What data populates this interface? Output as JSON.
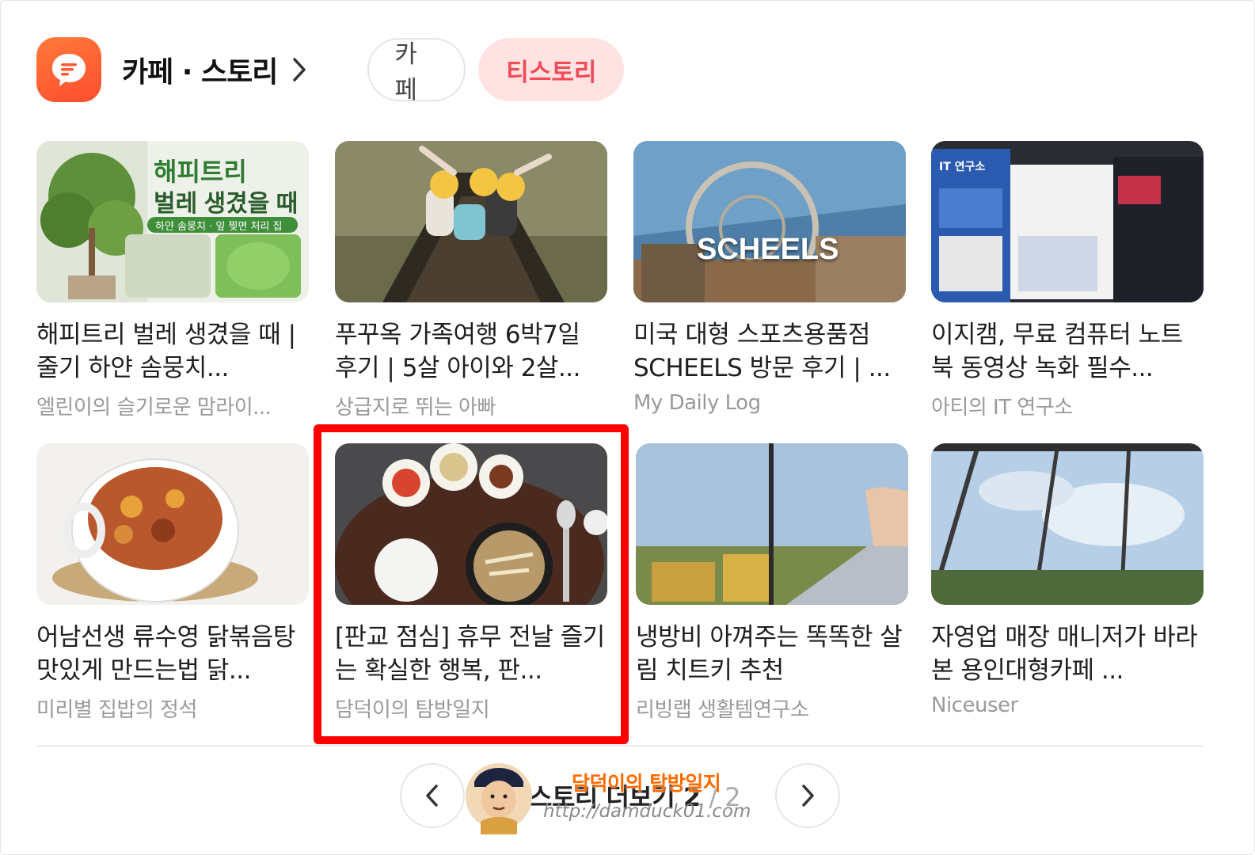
{
  "header": {
    "title": "카페 · 스토리",
    "tabs": [
      "카페",
      "티스토리"
    ],
    "active_tab": "티스토리"
  },
  "cards": [
    {
      "title": "해피트리 벌레 생겼을 때 | 줄기 하얀 솜뭉치...",
      "source": "엘린이의 슬기로운 맘라이...",
      "thumb_text": [
        "해피트리",
        "벌레 생겼을 때",
        "하얀 솜뭉치 · 잎 찢면 처리 집"
      ]
    },
    {
      "title": "푸꾸옥 가족여행 6박7일 후기 | 5살 아이와 2살...",
      "source": "상급지로 뛰는 아빠"
    },
    {
      "title": "미국 대형 스포츠용품점 SCHEELS 방문 후기 | ...",
      "source": "My Daily Log",
      "thumb_text": [
        "SCHEELS"
      ]
    },
    {
      "title": "이지캠, 무료 컴퓨터 노트북 동영상 녹화 필수...",
      "source": "아티의 IT 연구소",
      "thumb_text": [
        "IT 연구소"
      ]
    },
    {
      "title": "어남선생 류수영 닭볶음탕 맛있게 만드는법 닭...",
      "source": "미리별 집밥의 정석"
    },
    {
      "title": "[판교 점심] 휴무 전날 즐기는 확실한 행복, 판...",
      "source": "담덕이의 탐방일지"
    },
    {
      "title": "냉방비 아껴주는 똑똑한 살림 치트키 추천",
      "source": "리빙랩 생활템연구소"
    },
    {
      "title": "자영업 매장 매니저가 바라본 용인대형카페 ...",
      "source": "Niceuser"
    }
  ],
  "pager": {
    "label": "스토리 더보기",
    "current": "2",
    "total": "/ 2"
  },
  "watermark": {
    "name": "담덕이의 탐방일지",
    "url": "http://damduck01.com"
  },
  "colors": {
    "accent": "#f14b57",
    "accent_bg": "#ffe3e3",
    "app_icon": "#ff5a30",
    "highlight": "#ff0000"
  }
}
